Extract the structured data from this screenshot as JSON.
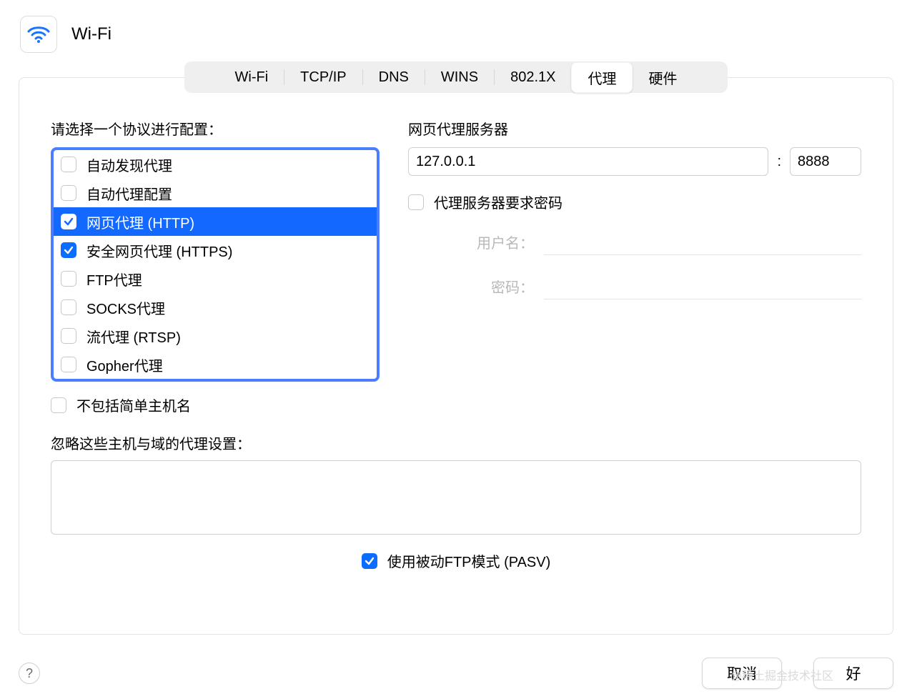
{
  "header": {
    "title": "Wi-Fi"
  },
  "tabs": {
    "items": [
      "Wi-Fi",
      "TCP/IP",
      "DNS",
      "WINS",
      "802.1X",
      "代理",
      "硬件"
    ],
    "active_index": 5
  },
  "left": {
    "select_label": "请选择一个协议进行配置：",
    "protocols": [
      {
        "label": "自动发现代理",
        "checked": false,
        "selected": false
      },
      {
        "label": "自动代理配置",
        "checked": false,
        "selected": false
      },
      {
        "label": "网页代理 (HTTP)",
        "checked": true,
        "selected": true
      },
      {
        "label": "安全网页代理 (HTTPS)",
        "checked": true,
        "selected": false
      },
      {
        "label": "FTP代理",
        "checked": false,
        "selected": false
      },
      {
        "label": "SOCKS代理",
        "checked": false,
        "selected": false
      },
      {
        "label": "流代理 (RTSP)",
        "checked": false,
        "selected": false
      },
      {
        "label": "Gopher代理",
        "checked": false,
        "selected": false
      }
    ],
    "exclude_simple": {
      "label": "不包括简单主机名",
      "checked": false
    }
  },
  "right": {
    "server_label": "网页代理服务器",
    "host": "127.0.0.1",
    "port": "8888",
    "colon": ":",
    "auth_label": "代理服务器要求密码",
    "auth_checked": false,
    "username_label": "用户名：",
    "password_label": "密码：",
    "username_value": "",
    "password_value": ""
  },
  "bypass": {
    "label": "忽略这些主机与域的代理设置：",
    "value": ""
  },
  "pasv": {
    "label": "使用被动FTP模式 (PASV)",
    "checked": true
  },
  "footer": {
    "help": "?",
    "cancel": "取消",
    "ok": "好"
  },
  "watermark": "@稀土掘金技术社区"
}
